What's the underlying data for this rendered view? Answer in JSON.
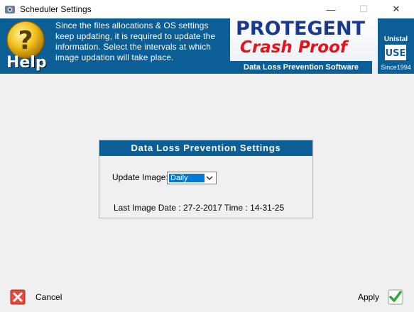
{
  "window": {
    "title": "Scheduler Settings",
    "minimize_glyph": "—",
    "maximize_glyph": "☐",
    "close_glyph": "✕"
  },
  "banner": {
    "help_label": "Help",
    "help_text": "Since the files allocations & OS settings keep updating, it is required to update the information. Select the intervals at which image updation will take place.",
    "brand_top": "PROTEGENT",
    "brand_main": "Crash Proof",
    "brand_sub": "Data Loss Prevention Software",
    "company": "Unistal",
    "company_logo_text": "USE",
    "since": "Since1994"
  },
  "panel": {
    "title": "Data Loss Prevention Settings",
    "update_label": "Update Image:",
    "update_value": "Daily",
    "last_image_text": "Last Image  Date : 27-2-2017  Time : 14-31-25"
  },
  "footer": {
    "cancel_label": "Cancel",
    "apply_label": "Apply"
  },
  "colors": {
    "banner_blue": "#0b5e96",
    "brand_red": "#e8101a",
    "brand_navy": "#1b3a8c",
    "selection_blue": "#0078d7"
  }
}
